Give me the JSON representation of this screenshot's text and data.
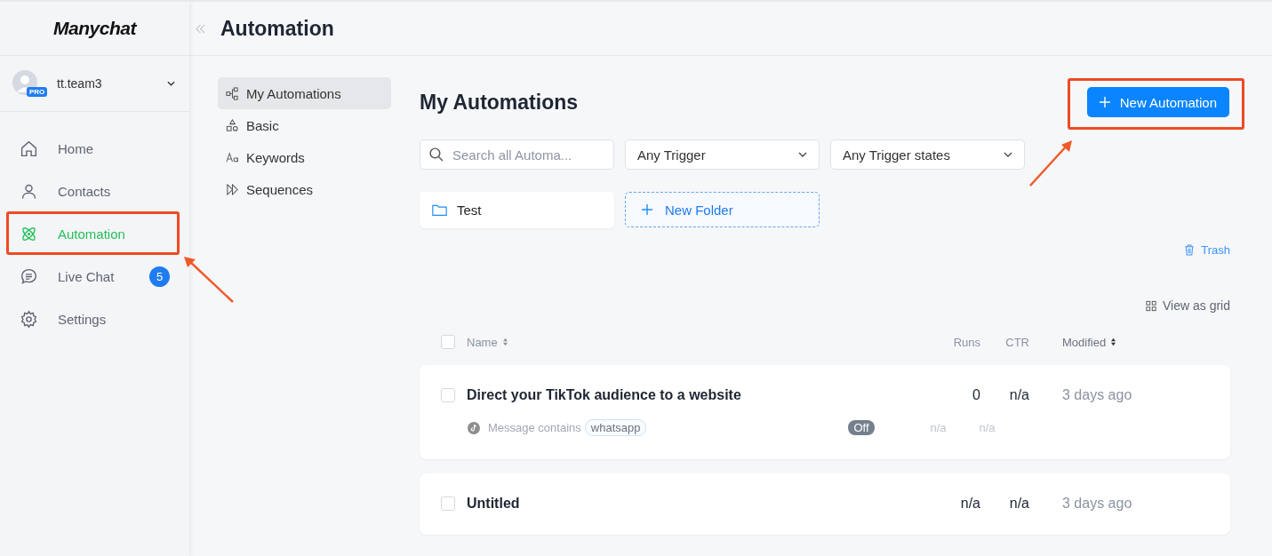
{
  "sidebar": {
    "logo": "Manychat",
    "account": {
      "name": "tt.team3",
      "badge": "PRO"
    },
    "items": [
      {
        "label": "Home",
        "selected": false
      },
      {
        "label": "Contacts",
        "selected": false
      },
      {
        "label": "Automation",
        "selected": true
      },
      {
        "label": "Live Chat",
        "selected": false,
        "count": "5"
      },
      {
        "label": "Settings",
        "selected": false
      }
    ]
  },
  "header": {
    "title": "Automation"
  },
  "subnav": [
    {
      "label": "My Automations",
      "selected": true
    },
    {
      "label": "Basic",
      "selected": false
    },
    {
      "label": "Keywords",
      "selected": false
    },
    {
      "label": "Sequences",
      "selected": false
    }
  ],
  "main": {
    "title": "My Automations",
    "new_button": "New Automation",
    "search": {
      "placeholder": "Search all Automa..."
    },
    "filters": [
      "Any Trigger",
      "Any Trigger states"
    ],
    "folders": [
      {
        "label": "Test"
      }
    ],
    "new_folder": "New Folder",
    "trash": "Trash",
    "view_toggle": "View as grid",
    "table": {
      "select_all_checked": false,
      "columns": [
        {
          "label": "Name",
          "sortable": true
        },
        {
          "label": "Runs",
          "sortable": false
        },
        {
          "label": "CTR",
          "sortable": false
        },
        {
          "label": "Modified",
          "sortable": true
        }
      ],
      "rows": [
        {
          "checked": false,
          "name": "Direct your TikTok audience to a website",
          "runs": "0",
          "ctr": "n/a",
          "modified": "3 days ago",
          "trigger": {
            "text": "Message contains",
            "keyword": "whatsapp"
          },
          "status": "Off",
          "sub_runs": "n/a",
          "sub_ctr": "n/a"
        },
        {
          "checked": false,
          "name": "Untitled",
          "runs": "n/a",
          "ctr": "n/a",
          "modified": "3 days ago"
        }
      ]
    }
  }
}
